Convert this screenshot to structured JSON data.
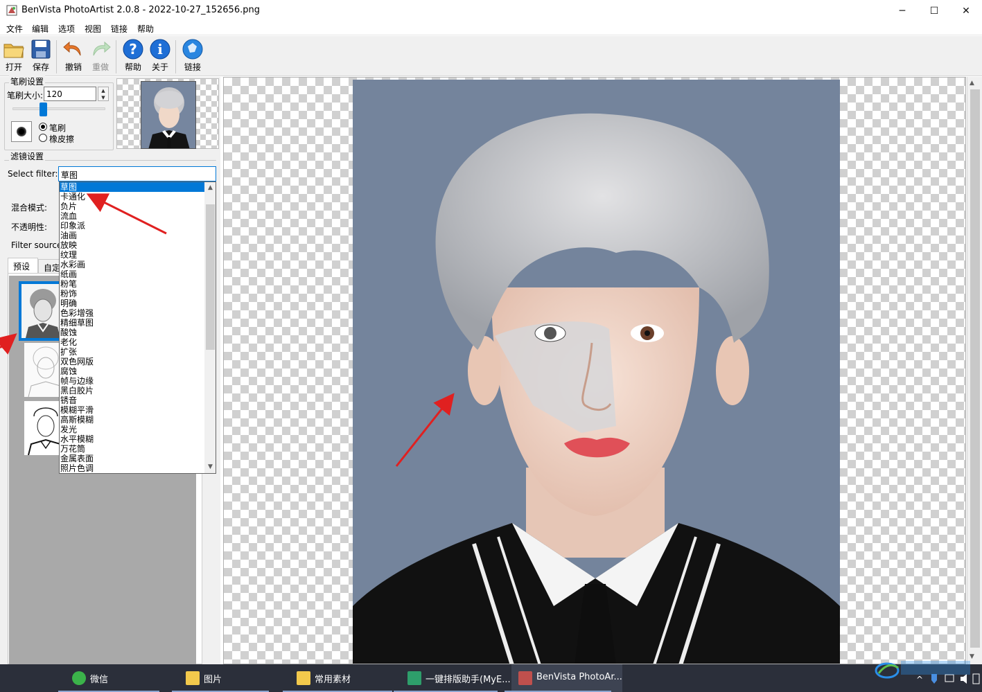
{
  "window": {
    "title": "BenVista PhotoArtist 2.0.8 - 2022-10-27_152656.png",
    "minimize": "─",
    "maximize": "☐",
    "close": "✕"
  },
  "menu": [
    "文件",
    "编辑",
    "选项",
    "视图",
    "链接",
    "帮助"
  ],
  "toolbar": {
    "open": "打开",
    "save": "保存",
    "undo": "撤销",
    "redo": "重做",
    "help": "帮助",
    "about": "关于",
    "link": "链接"
  },
  "brush_settings": {
    "group_label": "笔刷设置",
    "size_label": "笔刷大小:",
    "size_value": "120",
    "size_level": 0.33,
    "mode_brush": "笔刷",
    "mode_eraser": "橡皮擦",
    "selected_mode": "笔刷"
  },
  "filter_settings": {
    "group_label": "滤镜设置",
    "select_label": "Select filter:",
    "selected": "草图",
    "blend_label": "混合模式:",
    "opacity_label": "不透明性:",
    "source_label": "Filter source:",
    "tab_presets": "预设",
    "tab_custom": "自定义"
  },
  "filter_options": [
    "草图",
    "卡通化",
    "负片",
    "流血",
    "印象派",
    "油画",
    "放映",
    "纹理",
    "水彩画",
    "纸画",
    "粉笔",
    "粉饰",
    "明确",
    "色彩增强",
    "精细草图",
    "酸蚀",
    "老化",
    "扩张",
    "双色网版",
    "腐蚀",
    "帧与边缘",
    "黑白胶片",
    "锈音",
    "模糊平滑",
    "高斯模糊",
    "发光",
    "水平模糊",
    "万花筒",
    "金属表面",
    "照片色调"
  ],
  "taskbar": [
    {
      "name": "微信",
      "color": "#3bb34a"
    },
    {
      "name": "图片",
      "color": "#f2c94c"
    },
    {
      "name": "常用素材",
      "color": "#f2c94c"
    },
    {
      "name": "一键排版助手(MyE...",
      "color": "#2e9e6b"
    },
    {
      "name": "BenVista PhotoAr...",
      "color": "#c0504d"
    }
  ],
  "colors": {
    "accent": "#0078d7",
    "photo_bg": "#74849c",
    "taskbar": "#2b2f3a",
    "arrow": "#e02020"
  }
}
